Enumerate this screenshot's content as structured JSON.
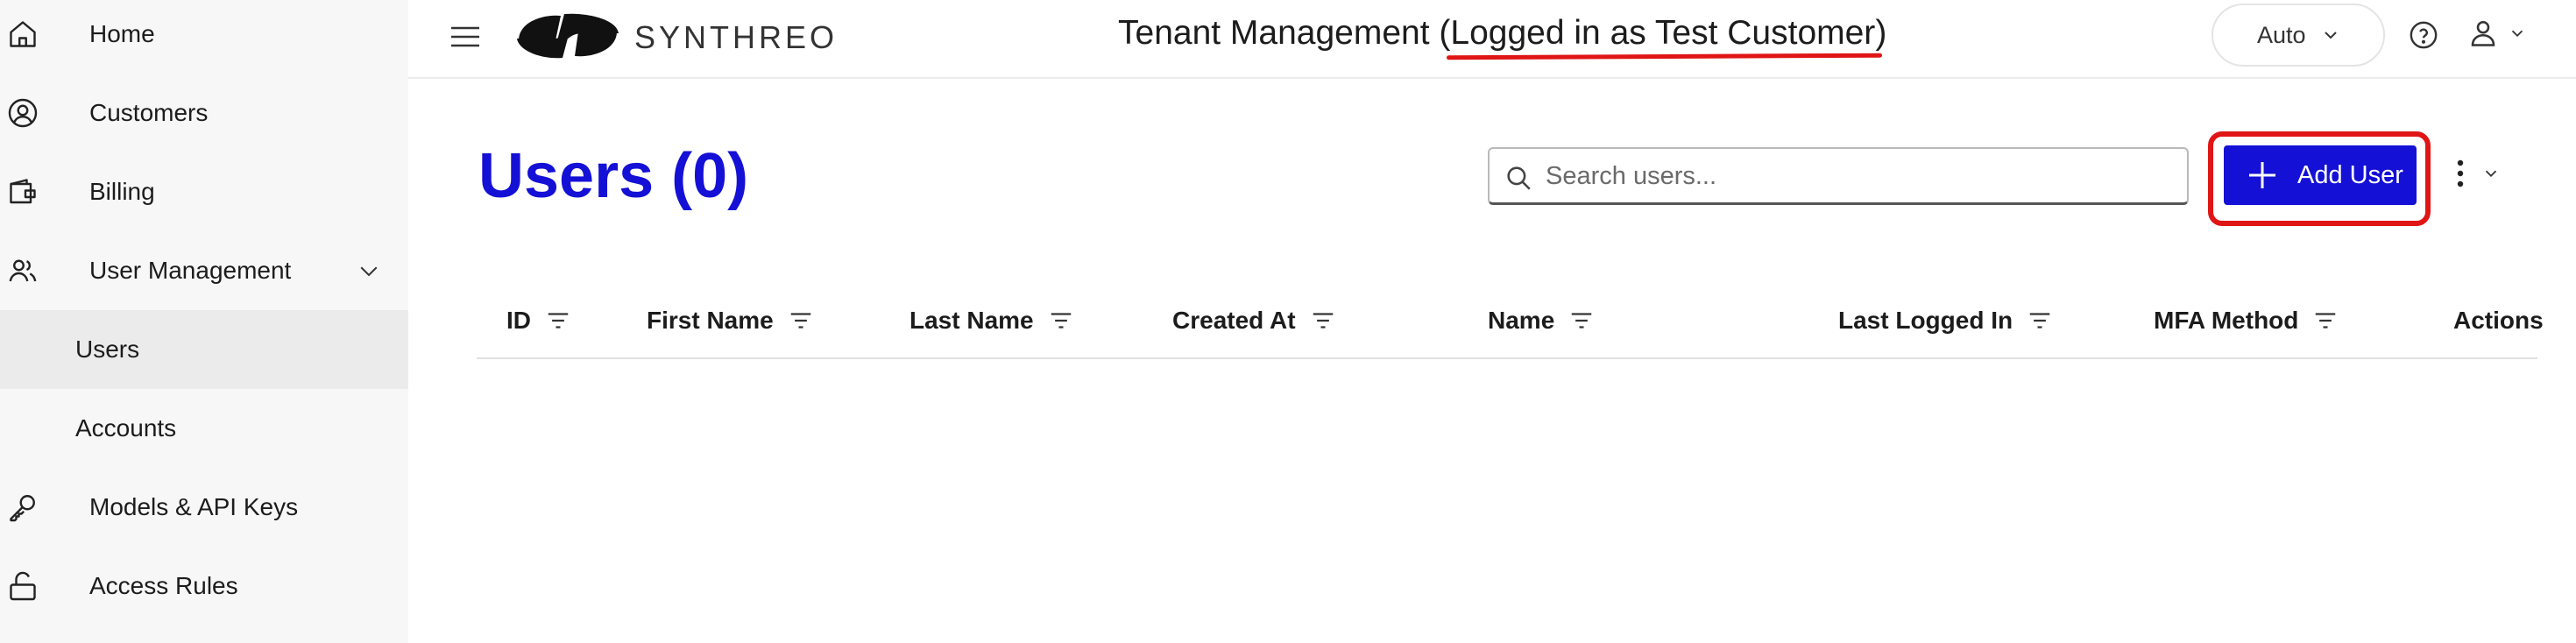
{
  "sidebar": {
    "items": [
      {
        "label": "Home",
        "icon": "home-icon"
      },
      {
        "label": "Customers",
        "icon": "user-circle-icon"
      },
      {
        "label": "Billing",
        "icon": "wallet-icon"
      },
      {
        "label": "User Management",
        "icon": "users-icon"
      },
      {
        "label": "Users"
      },
      {
        "label": "Accounts"
      },
      {
        "label": "Models & API Keys",
        "icon": "key-icon"
      },
      {
        "label": "Access Rules",
        "icon": "lock-icon"
      }
    ]
  },
  "header": {
    "brand": "SYNTHREO",
    "title_prefix": "Tenant Management (",
    "title_highlight": "Logged in as Test Customer",
    "title_suffix": ")",
    "mode": "Auto"
  },
  "main": {
    "title": "Users (0)",
    "search_placeholder": "Search users...",
    "add_button": "Add User"
  },
  "table": {
    "columns": [
      "ID",
      "First Name",
      "Last Name",
      "Created At",
      "Name",
      "Last Logged In",
      "MFA Method",
      "Actions"
    ]
  },
  "colors": {
    "accent": "#1410d6",
    "highlight": "#e01515"
  }
}
